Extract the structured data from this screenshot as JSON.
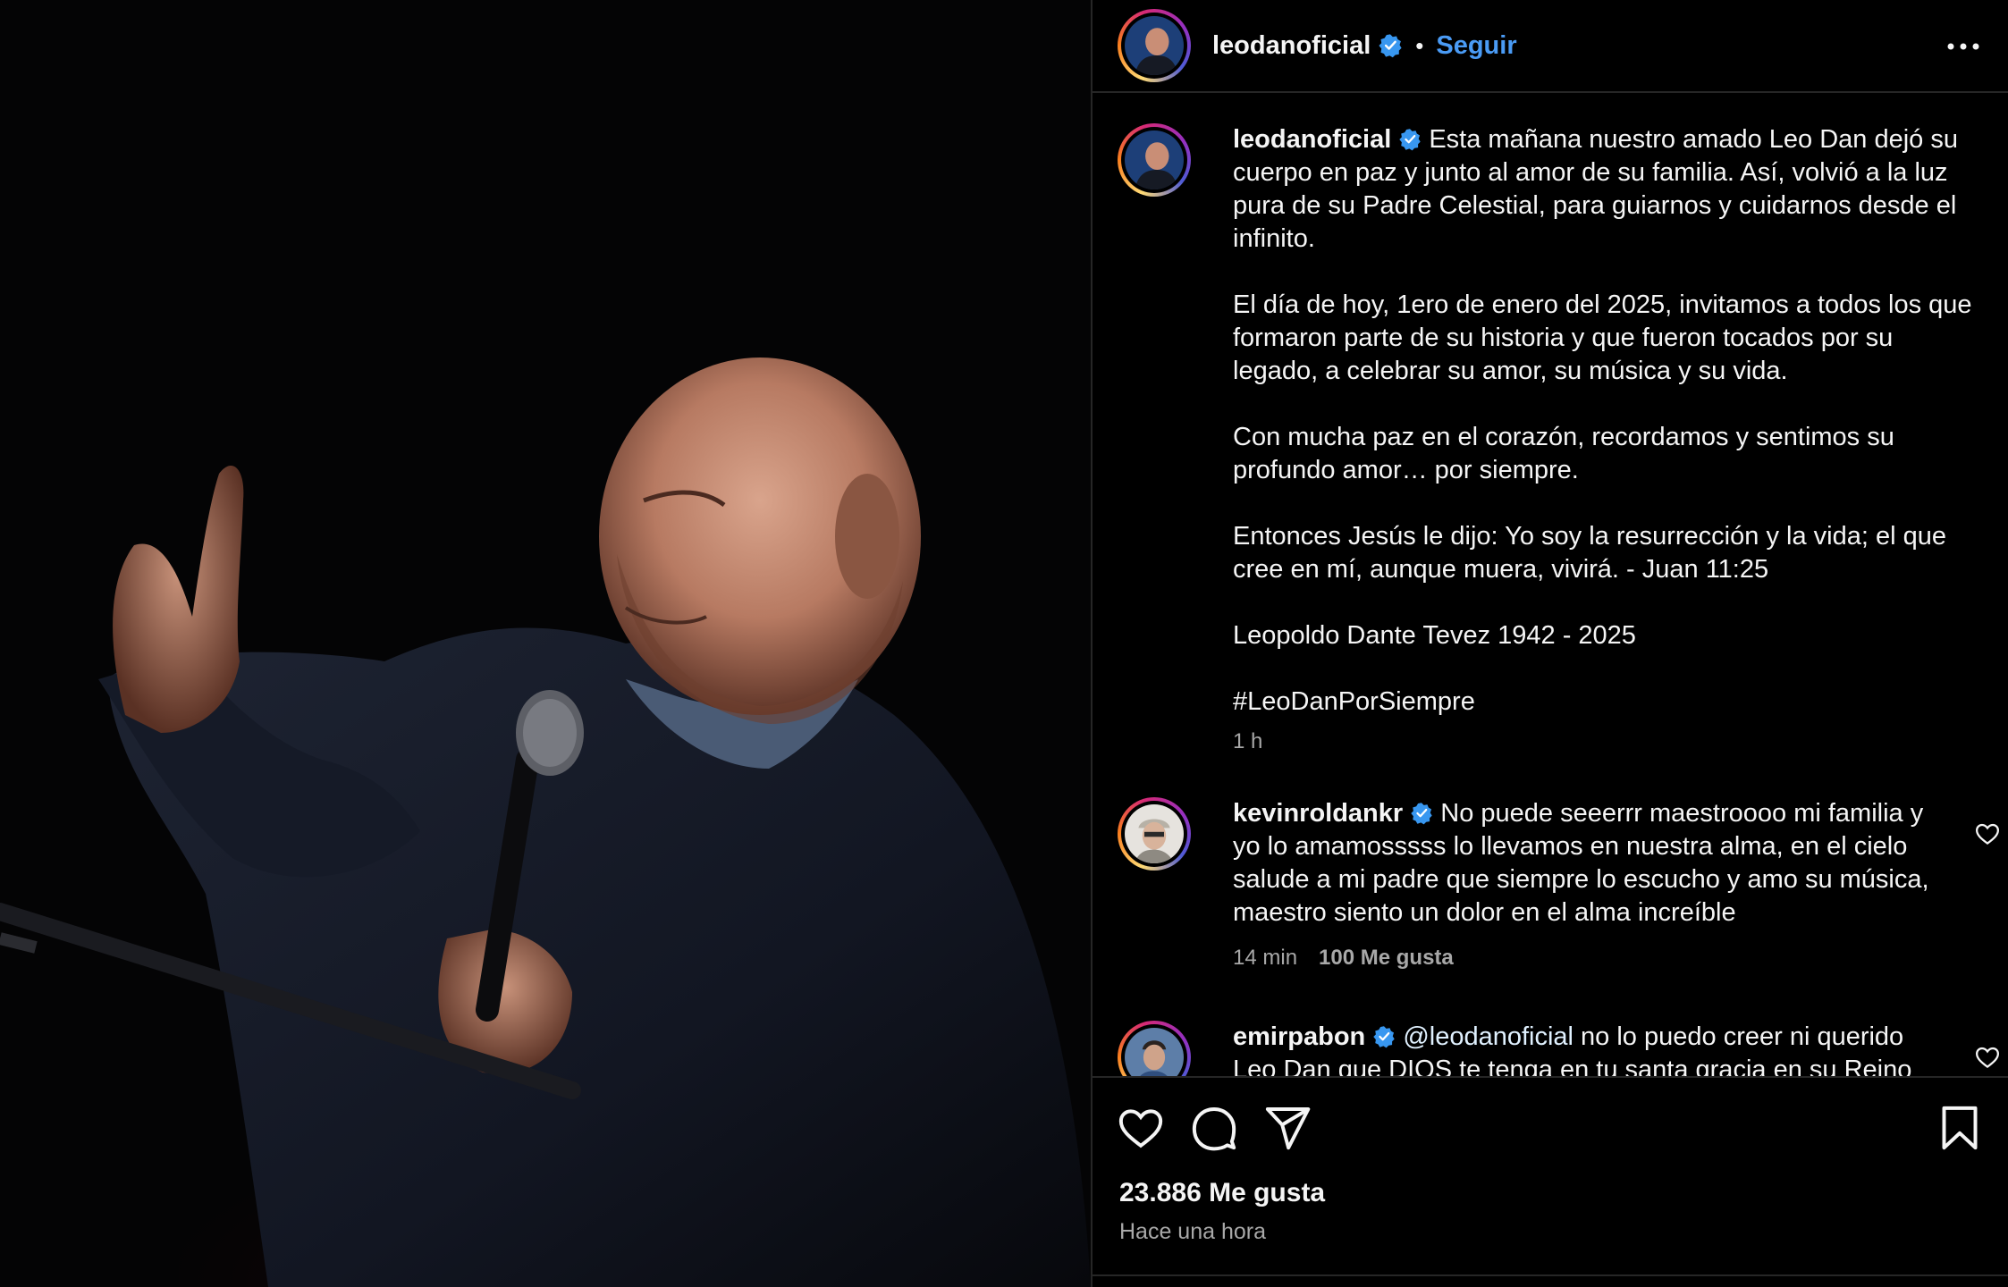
{
  "header": {
    "username": "leodanoficial",
    "follow_label": "Seguir",
    "separator": "•"
  },
  "caption": {
    "username": "leodanoficial",
    "paragraphs": [
      "Esta mañana nuestro amado Leo Dan dejó su cuerpo en paz y junto al amor de su familia. Así, volvió a la luz pura de su Padre Celestial, para guiarnos y cuidarnos desde el infinito.",
      "El día de hoy, 1ero de enero del 2025, invitamos a todos los que formaron parte de su historia y que fueron tocados por su legado, a celebrar su amor, su música y su vida.",
      "Con mucha paz en el corazón, recordamos y sentimos su profundo amor… por siempre.",
      "Entonces Jesús le dijo: Yo soy la resurrección y la vida; el que cree en mí, aunque muera, vivirá. - Juan 11:25",
      "Leopoldo Dante Tevez 1942 - 2025",
      "#LeoDanPorSiempre"
    ],
    "time": "1 h"
  },
  "comments": [
    {
      "username": "kevinroldankr",
      "text": "No puede seeerrr maestroooo mi familia y yo lo amamosssss lo llevamos en nuestra alma, en el cielo salude a mi padre que siempre lo escucho y amo su música, maestro siento un dolor en el alma increíble",
      "time": "14 min",
      "likes": "100 Me gusta"
    },
    {
      "username": "emirpabon",
      "mention": "@leodanoficial",
      "text": "no lo puedo creer ni querido Leo Dan que DIOS te tenga en tu santa gracia en su Reino"
    }
  ],
  "footer": {
    "likes": "23.886 Me gusta",
    "posted": "Hace una hora"
  },
  "icons": {
    "verified": "verified-badge-icon",
    "more": "more-options-icon",
    "like": "heart-icon",
    "comment": "comment-icon",
    "share": "share-icon",
    "save": "bookmark-icon"
  },
  "colors": {
    "background": "#000000",
    "text": "#f5f5f5",
    "muted": "#a8a8a8",
    "link": "#4a9bf5",
    "divider": "#262626"
  }
}
